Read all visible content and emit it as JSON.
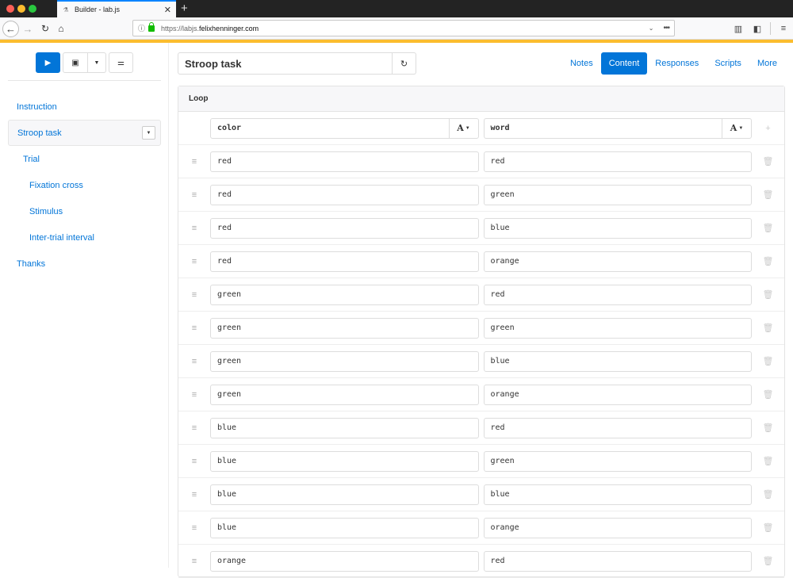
{
  "browser": {
    "tab_title": "Builder - lab.js",
    "tab_favicon": "flask-icon",
    "new_tab": "+",
    "url_prefix": "https://labjs.",
    "url_domain": "felixhenninger.com",
    "accent_color": "#fbbd2e"
  },
  "toolbar": {
    "run_icon": "▶",
    "save_icon": "🖫",
    "save_dropdown_icon": "▼",
    "options_icon": "☰"
  },
  "sidebar": {
    "items": [
      {
        "label": "Instruction",
        "level": 0
      },
      {
        "label": "Stroop task",
        "level": 0,
        "active": true
      },
      {
        "label": "Trial",
        "level": 1
      },
      {
        "label": "Fixation cross",
        "level": 2
      },
      {
        "label": "Stimulus",
        "level": 2
      },
      {
        "label": "Inter-trial interval",
        "level": 2
      },
      {
        "label": "Thanks",
        "level": 0
      }
    ]
  },
  "editor": {
    "title": "Stroop task",
    "tabs": [
      {
        "label": "Notes",
        "active": false
      },
      {
        "label": "Content",
        "active": true
      },
      {
        "label": "Responses",
        "active": false
      },
      {
        "label": "Scripts",
        "active": false
      },
      {
        "label": "More",
        "active": false
      }
    ],
    "card_title": "Loop",
    "columns": [
      {
        "name": "color",
        "type_label": "A"
      },
      {
        "name": "word",
        "type_label": "A"
      }
    ],
    "rows": [
      [
        "red",
        "red"
      ],
      [
        "red",
        "green"
      ],
      [
        "red",
        "blue"
      ],
      [
        "red",
        "orange"
      ],
      [
        "green",
        "red"
      ],
      [
        "green",
        "green"
      ],
      [
        "green",
        "blue"
      ],
      [
        "green",
        "orange"
      ],
      [
        "blue",
        "red"
      ],
      [
        "blue",
        "green"
      ],
      [
        "blue",
        "blue"
      ],
      [
        "blue",
        "orange"
      ],
      [
        "orange",
        "red"
      ]
    ]
  }
}
